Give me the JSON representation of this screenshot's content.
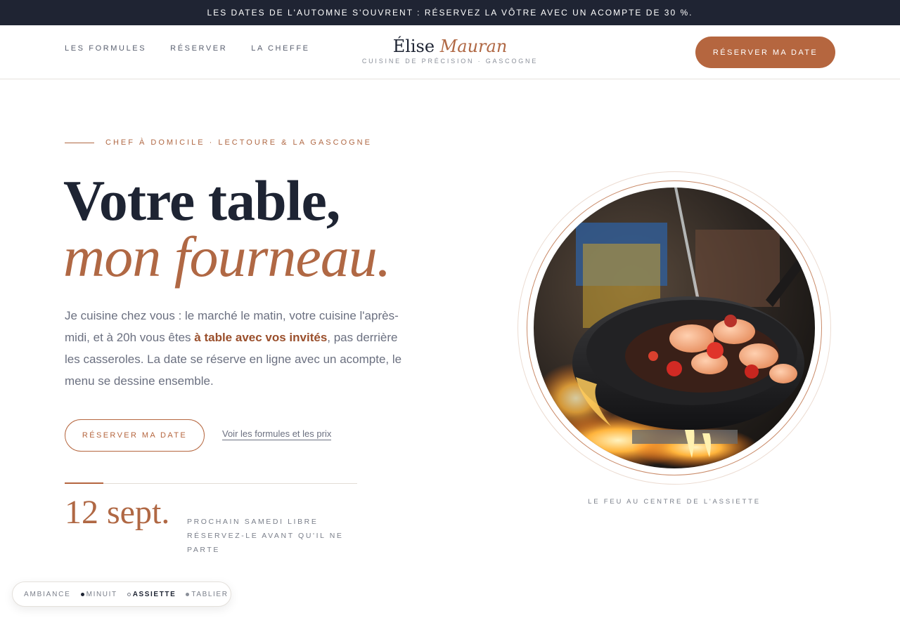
{
  "announcement": "LES DATES DE L'AUTOMNE S'OUVRENT : RÉSERVEZ LA VÔTRE AVEC UN ACOMPTE DE 30 %.",
  "nav": {
    "items": [
      {
        "label": "LES FORMULES"
      },
      {
        "label": "RÉSERVER"
      },
      {
        "label": "LA CHEFFE"
      }
    ]
  },
  "brand": {
    "first": "Élise",
    "last": "Mauran",
    "tagline": "CUISINE DE PRÉCISION · GASCOGNE"
  },
  "header_cta": "RÉSERVER MA DATE",
  "hero": {
    "eyebrow": "CHEF À DOMICILE · LECTOURE & LA GASCOGNE",
    "title_line1": "Votre table,",
    "title_line2": "mon fourneau.",
    "lede_part1": "Je cuisine chez vous : le marché le matin, votre cuisine l'après-midi, et à 20h vous êtes ",
    "lede_strong": "à table avec vos invités",
    "lede_part2": ", pas derrière les casseroles. La date se réserve en ligne avec un acompte, le menu se dessine ensemble.",
    "cta_primary": "RÉSERVER MA DATE",
    "cta_link": "Voir les formules et les prix",
    "next_date": "12 sept.",
    "next_note_line1": "PROCHAIN SAMEDI LIBRE",
    "next_note_line2": "RÉSERVEZ-LE AVANT QU'IL NE PARTE"
  },
  "photo": {
    "caption": "LE FEU AU CENTRE DE L'ASSIETTE",
    "icon": "pan-on-fire-photo"
  },
  "ambiance": {
    "label": "AMBIANCE",
    "options": [
      {
        "label": "MINUIT",
        "dot_color": "#1e2433"
      },
      {
        "label": "ASSIETTE",
        "dot_color": "#ffffff"
      },
      {
        "label": "TABLIER",
        "dot_color": "#8a8f99"
      }
    ],
    "selected": "ASSIETTE"
  },
  "colors": {
    "accent": "#b5663f",
    "ink": "#1e2433",
    "topbar": "#1f2433"
  }
}
